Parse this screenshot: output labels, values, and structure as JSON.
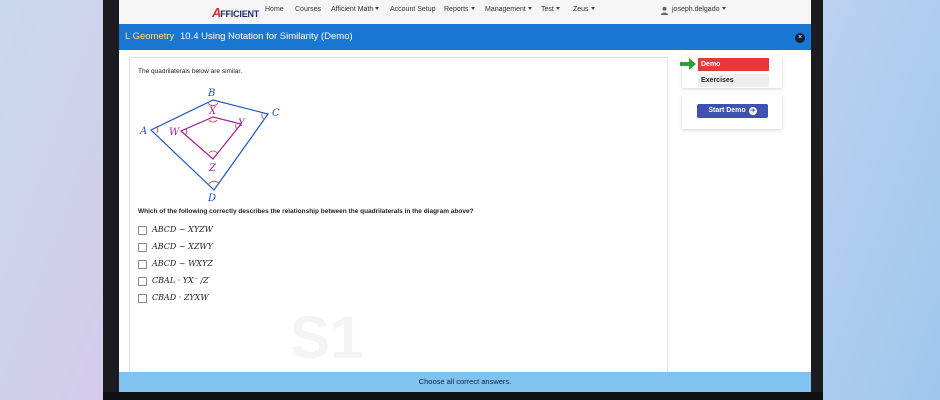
{
  "navbar": {
    "logo_prefix": "A",
    "logo_text": "FFICIENT",
    "items": [
      "Home",
      "Courses",
      "Afficient Math",
      "Account Setup",
      "Reports",
      "Management",
      "Test",
      "Zeus"
    ],
    "user": "joseph.delgado"
  },
  "header": {
    "course": "L Geometry",
    "lesson": "10.4 Using Notation for Similarity (Demo)",
    "close_icon": "×"
  },
  "problem": {
    "intro": "The quadrilaterals below are similar.",
    "diagram_labels": {
      "A": "A",
      "B": "B",
      "C": "C",
      "D": "D",
      "W": "W",
      "X": "X",
      "Y": "Y",
      "Z": "Z"
    },
    "question": "Which of the following correctly describes the relationship between the quadrilaterals in the diagram above?",
    "options": [
      "ABCD ∼ XYZW",
      "ABCD ∼ XZWY",
      "ABCD ∼ WXYZ",
      "CBAL · YX⁻ /Z",
      "CBAD · ZYXW"
    ]
  },
  "sidebar": {
    "demo_label": "Demo",
    "exercises_label": "Exercises",
    "start_label": "Start Demo"
  },
  "footer": {
    "instruction": "Choose all correct answers."
  },
  "colors": {
    "header_bar": "#1976d2",
    "course_text": "#ffe066",
    "demo_tab": "#e53935",
    "start_button": "#3f51b5",
    "footer_bar": "#81c3f0",
    "outer_quad": "#1a56c4",
    "inner_quad": "#a0209a"
  }
}
